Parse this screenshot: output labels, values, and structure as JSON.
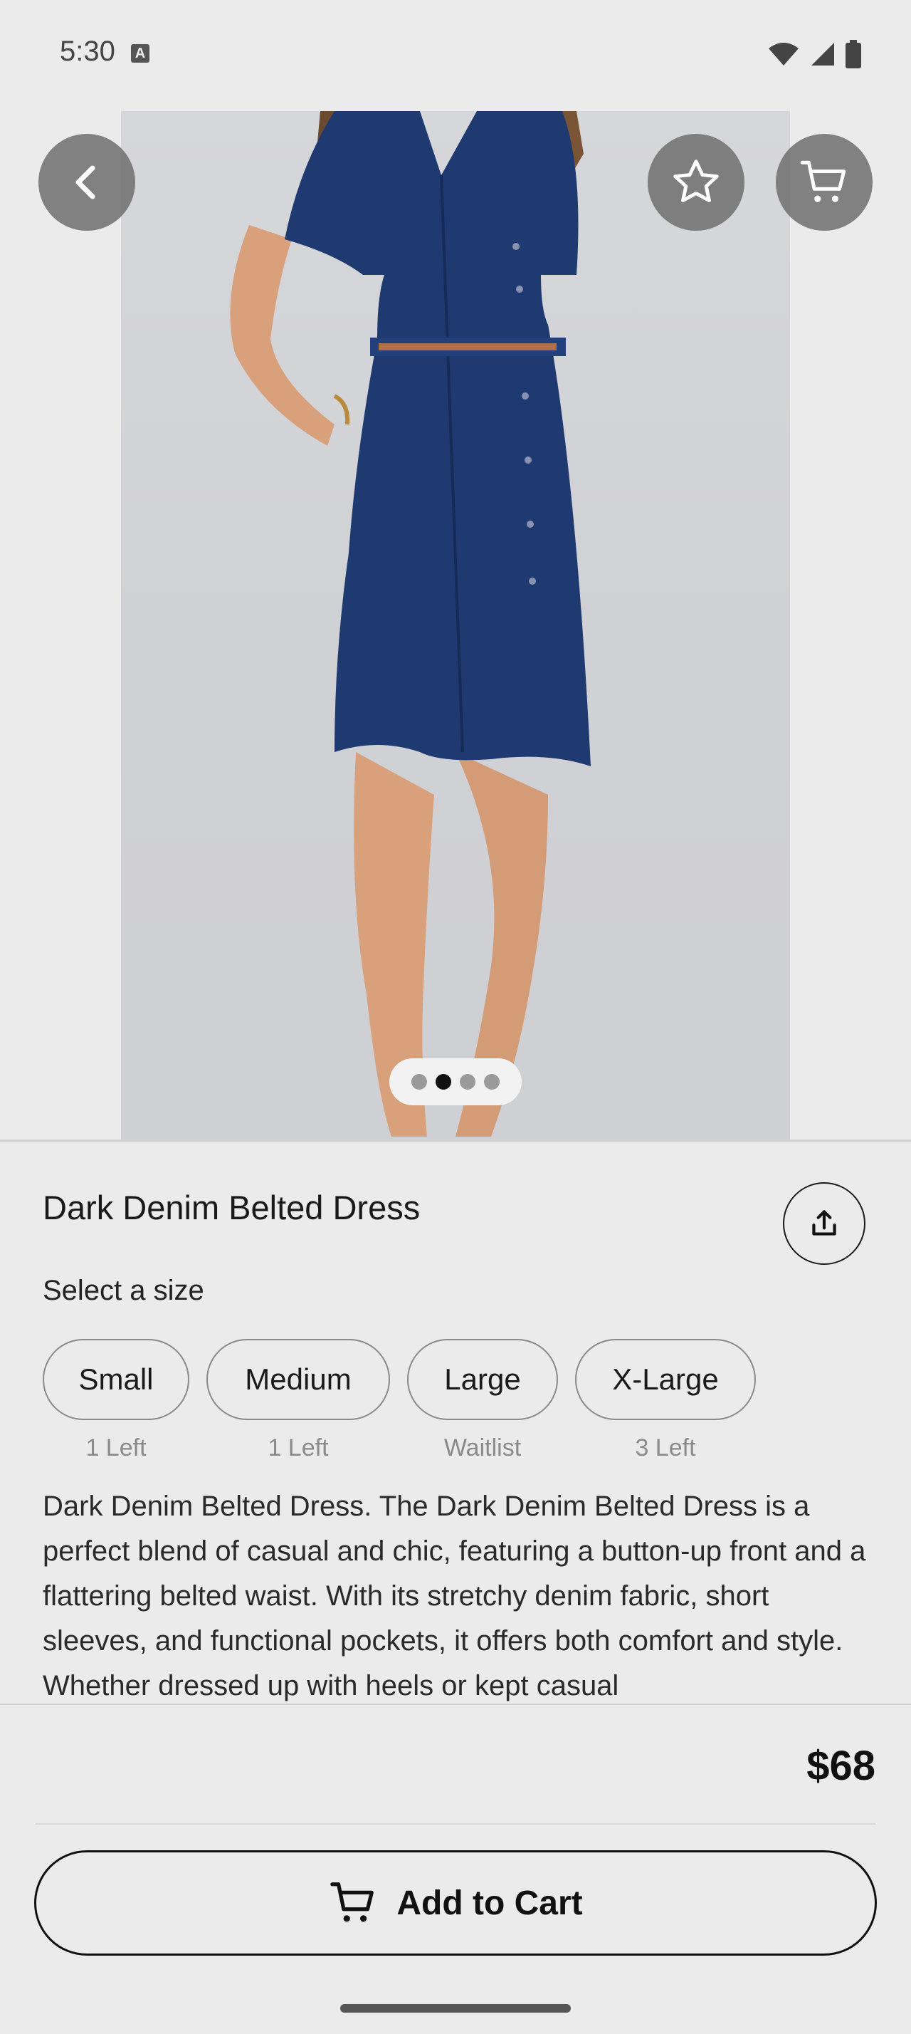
{
  "status_bar": {
    "time": "5:30",
    "notification_icon": "a-icon"
  },
  "hero": {
    "pager": {
      "count": 4,
      "active_index": 1
    },
    "buttons": {
      "back_icon": "chevron-left-icon",
      "favorite_icon": "star-icon",
      "cart_icon": "cart-icon"
    }
  },
  "product": {
    "title": "Dark Denim Belted Dress",
    "size_heading": "Select a size",
    "sizes": [
      {
        "label": "Small",
        "stock": "1 Left"
      },
      {
        "label": "Medium",
        "stock": "1 Left"
      },
      {
        "label": "Large",
        "stock": "Waitlist"
      },
      {
        "label": "X-Large",
        "stock": "3 Left"
      }
    ],
    "description": "Dark Denim Belted Dress. The Dark Denim Belted Dress is a perfect blend of casual and chic, featuring a button-up front and a flattering belted waist. With its stretchy denim fabric, short sleeves, and functional pockets, it offers both comfort and style. Whether dressed up with heels or kept casual",
    "price": "$68"
  },
  "footer": {
    "add_to_cart_label": "Add to Cart"
  },
  "colors": {
    "background": "#ebebeb",
    "denim": "#1f3a70",
    "overlay_button": "#6e6e6e"
  }
}
